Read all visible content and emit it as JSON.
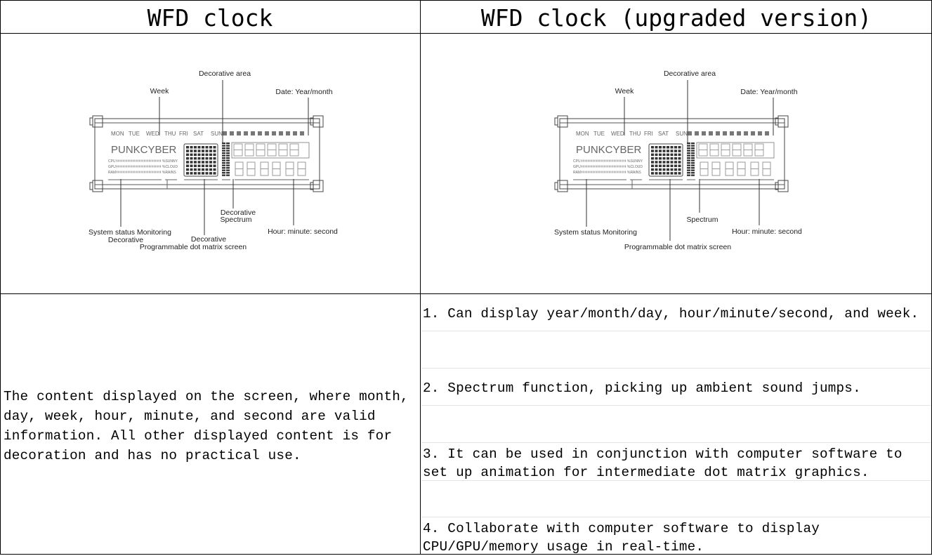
{
  "table": {
    "headers": [
      "WFD clock",
      "WFD clock (upgraded version)"
    ],
    "left_description": [
      "The content displayed on the screen, where month,",
      "day, week, hour, minute, and second are valid",
      "information. All other displayed content is for",
      "decoration and has no practical use."
    ],
    "features": [
      {
        "lines": [
          "1. Can display year/month/day, hour/minute/second, and week."
        ]
      },
      {
        "lines": [
          "2. Spectrum function, picking up ambient sound jumps."
        ]
      },
      {
        "lines": [
          "3. It can be used in conjunction with computer software to",
          "set up animation for intermediate dot matrix graphics."
        ]
      },
      {
        "lines": [
          "4. Collaborate with computer software to display",
          "CPU/GPU/memory usage in real-time."
        ]
      }
    ]
  },
  "diagram_left": {
    "labels": {
      "decorative_area": "Decorative area",
      "week": "Week",
      "date": "Date: Year/month",
      "system_status_1": "System status Monitoring",
      "system_status_2": "Decorative",
      "dot_matrix_1": "Decorative",
      "dot_matrix_2": "Programmable dot matrix screen",
      "spectrum_1": "Decorative",
      "spectrum_2": "Spectrum",
      "time": "Hour: minute: second"
    }
  },
  "diagram_right": {
    "labels": {
      "decorative_area": "Decorative area",
      "week": "Week",
      "date": "Date: Year/month",
      "system_status_1": "System status Monitoring",
      "dot_matrix_2": "Programmable dot matrix screen",
      "spectrum_2": "Spectrum",
      "time": "Hour: minute: second"
    }
  },
  "lcd": {
    "days": [
      "MON",
      "TUE",
      "WED",
      "THU",
      "FRI",
      "SAT",
      "SUN"
    ],
    "brand": "PUNKCYBER",
    "status_rows": [
      {
        "left": "CPU",
        "right": "%SUNNY"
      },
      {
        "left": "GPU",
        "right": "%CLOUD"
      },
      {
        "left": "RAM",
        "right": "%RAINS"
      }
    ]
  }
}
